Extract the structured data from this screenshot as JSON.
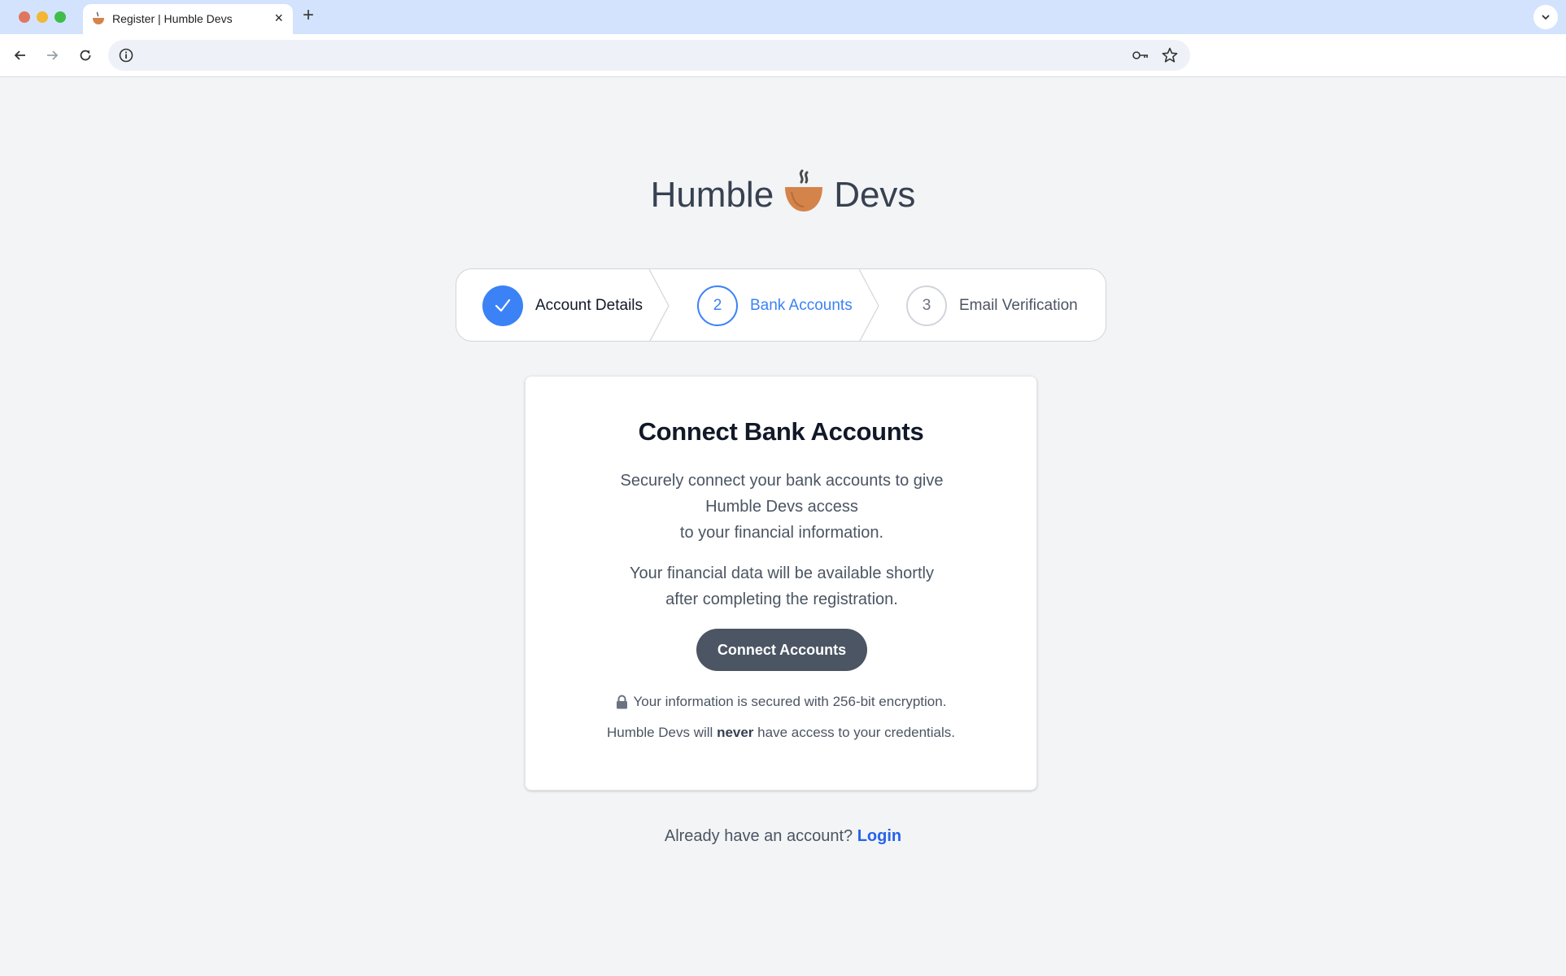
{
  "browser": {
    "tab_title": "Register | Humble Devs",
    "new_tab_symbol": "+",
    "close_symbol": "×"
  },
  "brand": {
    "left_word": "Humble",
    "right_word": "Devs",
    "logo_icon": "coffee-cup-icon",
    "logo_color": "#d4844a"
  },
  "stepper": {
    "steps": [
      {
        "number": "1",
        "label": "Account Details",
        "state": "completed"
      },
      {
        "number": "2",
        "label": "Bank Accounts",
        "state": "current"
      },
      {
        "number": "3",
        "label": "Email Verification",
        "state": "upcoming"
      }
    ],
    "accent_color": "#3b82f6"
  },
  "card": {
    "title": "Connect Bank Accounts",
    "description_lines": [
      "Securely connect your bank accounts to give",
      "Humble Devs access",
      "to your financial information."
    ],
    "note_lines": [
      "Your financial data will be available shortly",
      "after completing the registration."
    ],
    "button_label": "Connect Accounts",
    "security_text": "Your information is secured with 256-bit encryption.",
    "credentials_prefix": "Humble Devs will ",
    "credentials_bold": "never",
    "credentials_suffix": " have access to your credentials."
  },
  "footer": {
    "prompt": "Already have an account?",
    "login_label": "Login"
  }
}
